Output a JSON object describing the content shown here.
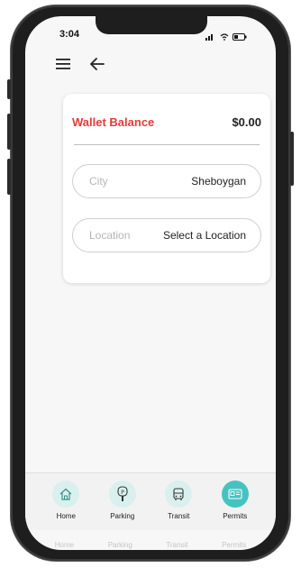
{
  "status_bar": {
    "time": "3:04"
  },
  "header": {
    "menu_icon": "hamburger-icon",
    "back_icon": "arrow-left-icon"
  },
  "wallet": {
    "label": "Wallet Balance",
    "amount": "$0.00"
  },
  "fields": {
    "city": {
      "label": "City",
      "value": "Sheboygan"
    },
    "location": {
      "label": "Location",
      "value": "Select a Location"
    }
  },
  "nav": [
    {
      "label": "Home",
      "icon": "home-icon"
    },
    {
      "label": "Parking",
      "icon": "parking-meter-icon"
    },
    {
      "label": "Transit",
      "icon": "bus-icon"
    },
    {
      "label": "Permits",
      "icon": "permit-card-icon",
      "active": true
    }
  ],
  "colors": {
    "accent": "#46c3c0",
    "wallet_label": "#e23b3b"
  }
}
